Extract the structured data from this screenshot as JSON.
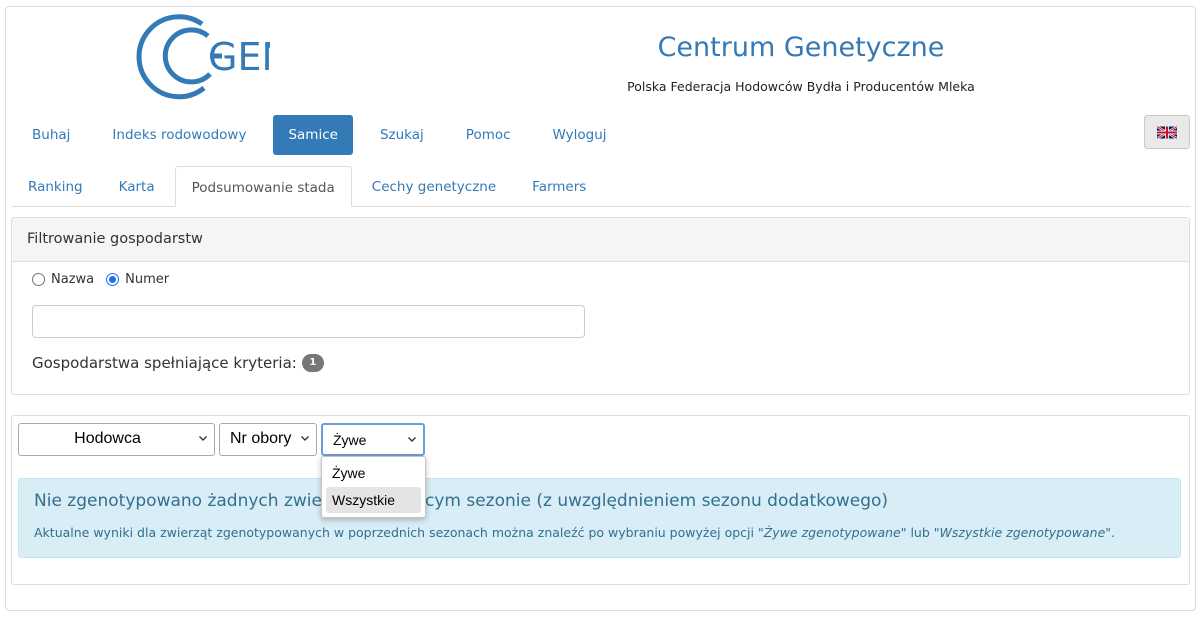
{
  "header": {
    "logo_text": "GEN",
    "title": "Centrum Genetyczne",
    "subtitle": "Polska Federacja Hodowców Bydła i Producentów Mleka",
    "brand_color": "#337ab7",
    "language_icon": "uk-flag-icon"
  },
  "main_nav": [
    {
      "label": "Buhaj",
      "active": false
    },
    {
      "label": "Indeks rodowodowy",
      "active": false
    },
    {
      "label": "Samice",
      "active": true
    },
    {
      "label": "Szukaj",
      "active": false
    },
    {
      "label": "Pomoc",
      "active": false
    },
    {
      "label": "Wyloguj",
      "active": false
    }
  ],
  "sub_tabs": [
    {
      "label": "Ranking",
      "active": false
    },
    {
      "label": "Karta",
      "active": false
    },
    {
      "label": "Podsumowanie stada",
      "active": true
    },
    {
      "label": "Cechy genetyczne",
      "active": false
    },
    {
      "label": "Farmers",
      "active": false
    }
  ],
  "filter": {
    "heading": "Filtrowanie gospodarstw",
    "radio_options": [
      {
        "label": "Nazwa",
        "checked": false
      },
      {
        "label": "Numer",
        "checked": true
      }
    ],
    "input_value": "",
    "match_label": "Gospodarstwa spełniające kryteria:",
    "match_count": "1"
  },
  "results": {
    "selects": {
      "breeder": "Hodowca",
      "barn": "Nr obory",
      "status": "Żywe"
    },
    "status_options": [
      {
        "label": "Żywe",
        "highlighted": false
      },
      {
        "label": "Wszystkie",
        "highlighted": true
      }
    ],
    "alert": {
      "title": "Nie zgenotypowano żadnych zwierząt w bieżącym sezonie (z uwzględnieniem sezonu dodatkowego)",
      "desc_prefix": "Aktualne wyniki dla zwierząt zgenotypowanych w poprzednich sezonach można znaleźć po wybraniu powyżej opcji",
      "quote1": "\"Żywe zgenotypowane\"",
      "desc_mid": "lub",
      "quote2": "\"Wszystkie zgenotypowane\"",
      "desc_suffix": ".",
      "background": "#d9edf7",
      "text_color": "#31708f"
    }
  }
}
